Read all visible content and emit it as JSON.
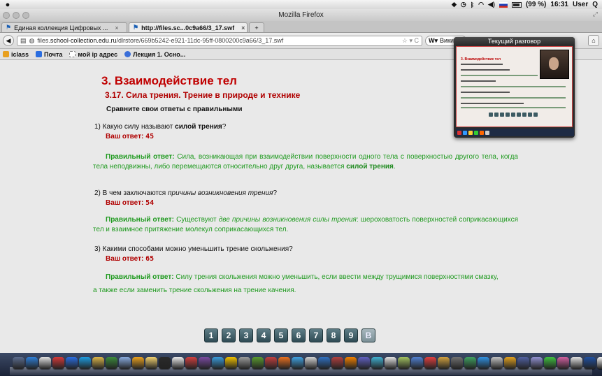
{
  "menubar": {
    "apple": "",
    "battery_text": "(99 %)",
    "clock": "16:31",
    "user": "User",
    "search_glyph": "Q",
    "icons": [
      "dropbox-icon",
      "time-machine-icon",
      "bluetooth-icon",
      "wifi-icon",
      "volume-icon",
      "flag-ru-icon",
      "battery-icon"
    ]
  },
  "window": {
    "title": "Mozilla Firefox"
  },
  "tabs": [
    {
      "label": "Единая коллекция Цифровых ...",
      "close": "×",
      "active": false
    },
    {
      "label": "http://files.sc...0c9a66/3_17.swf",
      "close": "×",
      "active": true
    }
  ],
  "newtab_label": "+",
  "nav": {
    "url_prefix": "files.",
    "url_domain": "school-collection.edu.ru",
    "url_path": "/dlrstore/669b5242-e921-11dc-95ff-0800200c9a66/3_17.swf",
    "url_right": "☆ ▾ C",
    "search_text": "Википе"
  },
  "bookmarks": [
    {
      "label": "iclass",
      "color": "#e8a020"
    },
    {
      "label": "Почта",
      "color": "#2a6de0"
    },
    {
      "label": "мой ip адрес",
      "color": "#ffffff"
    },
    {
      "label": "Лекция 1. Осно...",
      "color": "#3b6fd9"
    }
  ],
  "page": {
    "title": "3. Взаимодействие тел",
    "subtitle": "3.17. Сила трения. Трение в природе и технике",
    "instruction": "Сравните свои ответы с правильными",
    "answer_label": "Ваш ответ:",
    "correct_label": "Правильный ответ:",
    "questions": [
      {
        "q_before": "1) Какую силу называют ",
        "q_bold": "силой трения",
        "q_after": "?",
        "answer": "45",
        "correct_before": " Сила, возникающая при взаимодействии поверхности одного тела с поверхностью другого тела, когда тела неподвижны, либо перемещаются относительно друг друга, называется ",
        "correct_bold": "силой трения",
        "correct_after": "."
      },
      {
        "q_before": "2) В чем заключаются ",
        "q_italic": "причины возникновения трения",
        "q_after": "?",
        "answer": "54",
        "correct_before": " Существуют ",
        "correct_italic": "две причины возникновения силы трения",
        "correct_after": ": шероховатость поверхностей соприкасающихся тел и взаимное притяжение молекул соприкасающихся тел."
      },
      {
        "q_text": "3) Какими способами можно уменьшить трение скольжения?",
        "answer": "65",
        "correct_before": " Силу трения скольжения можно уменьшить, если ввести между трущимися поверхностями смазку,",
        "correct_after": "а также если заменить трение скольжения на трение качения."
      }
    ],
    "pager": [
      "1",
      "2",
      "3",
      "4",
      "5",
      "6",
      "7",
      "8",
      "9",
      "В"
    ]
  },
  "chat": {
    "title": "Текущий разговор",
    "preview_title": "3. Взаимодействие тел"
  },
  "dock_colors": [
    "#5a6b8c",
    "#2f7fd6",
    "#e0e0e0",
    "#d43a3a",
    "#2a6de0",
    "#1d9be0",
    "#d9b44a",
    "#3c8a3c",
    "#88aadd",
    "#e8a020",
    "#f0d070",
    "#2a2a2a",
    "#e8e8e8",
    "#d04040",
    "#7a4aa0",
    "#3a9ad9",
    "#f0c000",
    "#9a9a9a",
    "#5a9a30",
    "#c04040",
    "#e87020",
    "#40a0e0",
    "#d0d0d0",
    "#3070c0",
    "#b04040",
    "#f08000",
    "#6060c0",
    "#40b0d0",
    "#e0e0e0",
    "#a0c060",
    "#5080d0",
    "#e04040",
    "#d0a040",
    "#707070",
    "#40a060",
    "#3090e0",
    "#c0c0c0",
    "#e0a020",
    "#5060a0",
    "#9090d0",
    "#40c040",
    "#d060a0",
    "#e0e0e0",
    "#2050a0",
    "#f0f0f0",
    "#404040"
  ]
}
